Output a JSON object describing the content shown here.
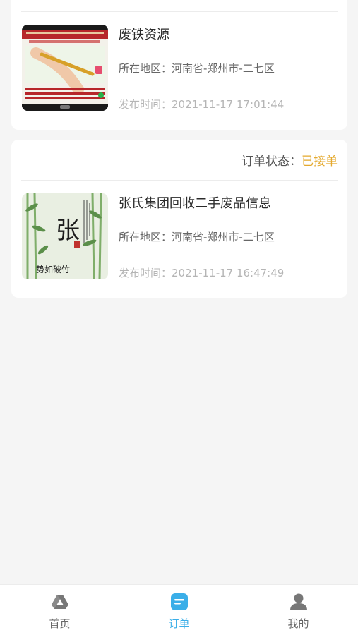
{
  "orders": [
    {
      "status_label": "",
      "status": "",
      "title": "废铁资源",
      "region_label": "所在地区：",
      "region": "河南省-郑州市-二七区",
      "time_label": "发布时间：",
      "time": "2021-11-17 17:01:44",
      "thumb_icon": "hand-writing-photo"
    },
    {
      "status_label": "订单状态：",
      "status": "已接单",
      "title": "张氏集团回收二手废品信息",
      "region_label": "所在地区：",
      "region": "河南省-郑州市-二七区",
      "time_label": "发布时间：",
      "time": "2021-11-17 16:47:49",
      "thumb_icon": "bamboo-calligraphy-photo",
      "thumb_char": "张",
      "thumb_caption": "势如破竹"
    }
  ],
  "tabbar": {
    "items": [
      {
        "label": "首页",
        "icon": "home-triangle-icon"
      },
      {
        "label": "订单",
        "icon": "order-doc-icon"
      },
      {
        "label": "我的",
        "icon": "user-icon"
      }
    ],
    "active_index": 1,
    "active_color": "#3aaee8",
    "inactive_color": "#777777"
  },
  "colors": {
    "status": "#e4a92e",
    "background": "#f5f5f5"
  }
}
